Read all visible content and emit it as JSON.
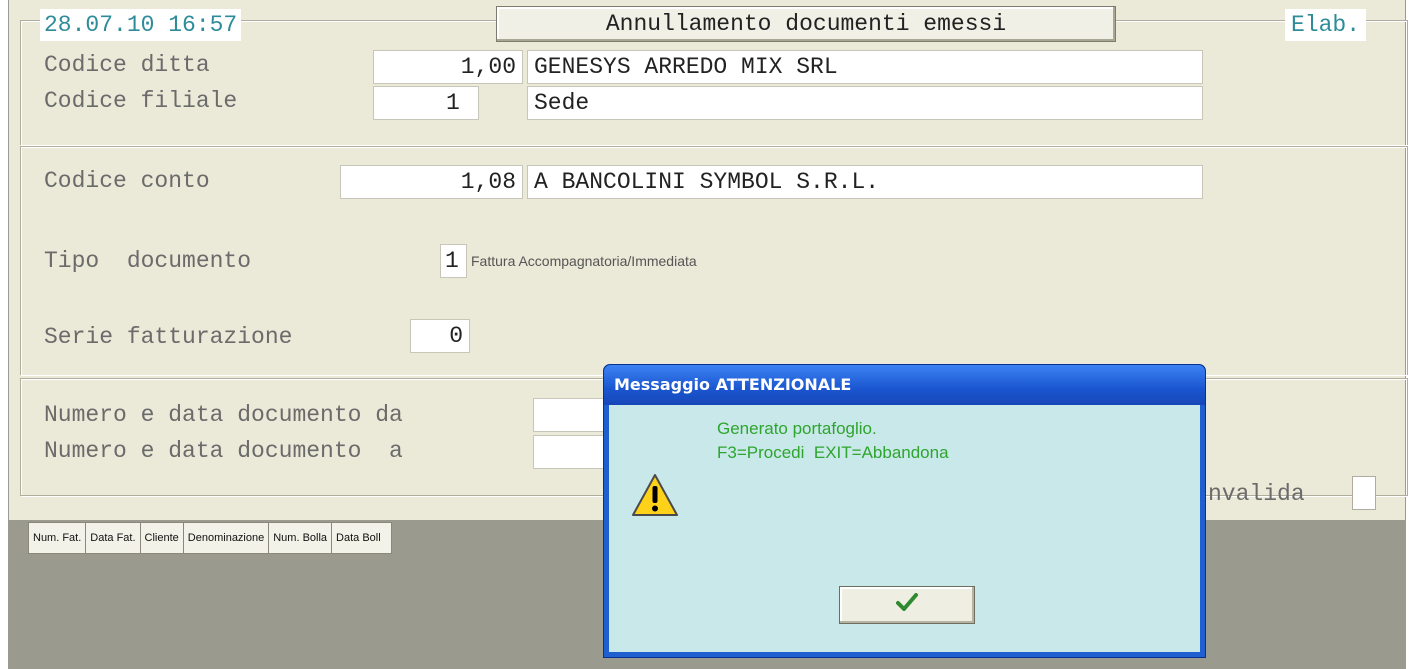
{
  "header": {
    "datetime": "28.07.10 16:57",
    "title": "Annullamento documenti emessi",
    "status": "Elab."
  },
  "ditta": {
    "label": "Codice ditta",
    "code": "1,00",
    "name": "GENESYS ARREDO MIX SRL"
  },
  "filiale": {
    "label": "Codice filiale",
    "code": "1",
    "name": "Sede"
  },
  "conto": {
    "label": "Codice conto",
    "code": "1,08",
    "name": "A BANCOLINI SYMBOL S.R.L."
  },
  "tipo_documento": {
    "label": "Tipo  documento",
    "code": "1",
    "description": "Fattura Accompagnatoria/Immediata"
  },
  "serie": {
    "label": "Serie fatturazione",
    "value": "0"
  },
  "numero_da": {
    "label": "Numero e data documento da",
    "value": ""
  },
  "numero_a": {
    "label": "Numero e data documento  a",
    "value": ""
  },
  "invalida_label": "nvalida",
  "table": {
    "columns": [
      "Num. Fat.",
      "Data Fat.",
      "Cliente",
      "Denominazione",
      "Num. Bolla",
      "Data Boll"
    ]
  },
  "dialog": {
    "title": "Messaggio ATTENZIONALE",
    "line1": "Generato portafoglio.",
    "line2": "F3=Procedi  EXIT=Abbandona",
    "icon": "warning-icon",
    "ok_icon": "checkmark-icon"
  },
  "colors": {
    "accent_teal": "#2e8c9a",
    "dialog_title": "#1f5fd0",
    "dialog_body": "#c9e8e9",
    "message_green": "#2ea52e"
  }
}
